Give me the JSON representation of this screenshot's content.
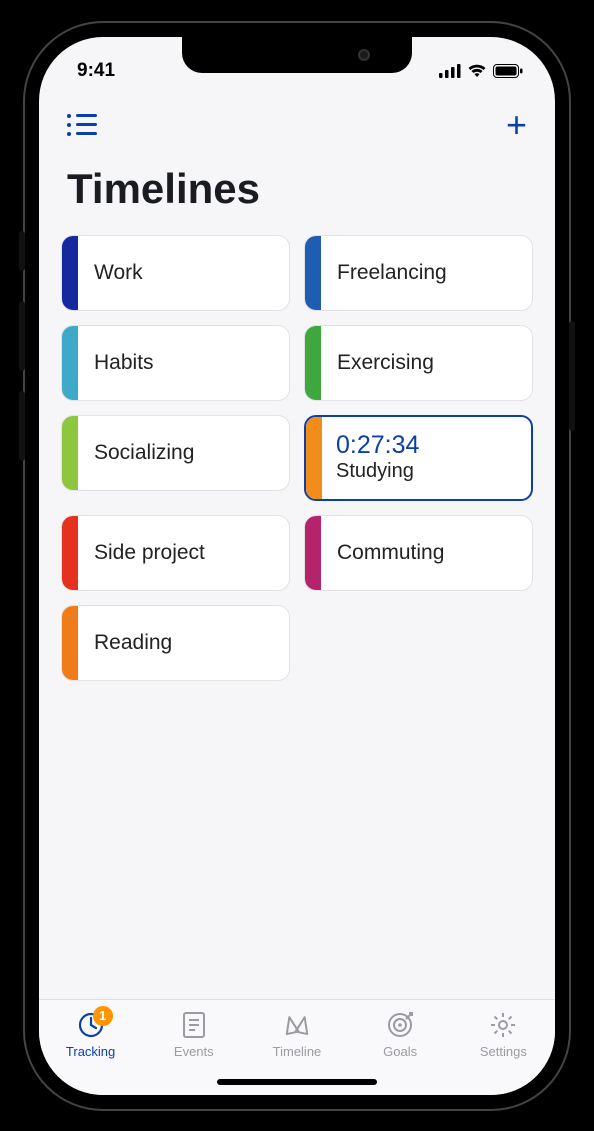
{
  "status": {
    "time": "9:41"
  },
  "header": {
    "title": "Timelines"
  },
  "cards": [
    {
      "label": "Work",
      "color": "#15299e",
      "active": false
    },
    {
      "label": "Freelancing",
      "color": "#1f5db3",
      "active": false
    },
    {
      "label": "Habits",
      "color": "#3fa9c9",
      "active": false
    },
    {
      "label": "Exercising",
      "color": "#3ea83e",
      "active": false
    },
    {
      "label": "Socializing",
      "color": "#8fc63f",
      "active": false
    },
    {
      "label": "Studying",
      "color": "#f28c1a",
      "active": true,
      "timer": "0:27:34"
    },
    {
      "label": "Side project",
      "color": "#e53220",
      "active": false
    },
    {
      "label": "Commuting",
      "color": "#b3246c",
      "active": false
    },
    {
      "label": "Reading",
      "color": "#f07b1a",
      "active": false
    }
  ],
  "tabs": [
    {
      "label": "Tracking",
      "badge": "1",
      "active": true
    },
    {
      "label": "Events",
      "active": false
    },
    {
      "label": "Timeline",
      "active": false
    },
    {
      "label": "Goals",
      "active": false
    },
    {
      "label": "Settings",
      "active": false
    }
  ]
}
